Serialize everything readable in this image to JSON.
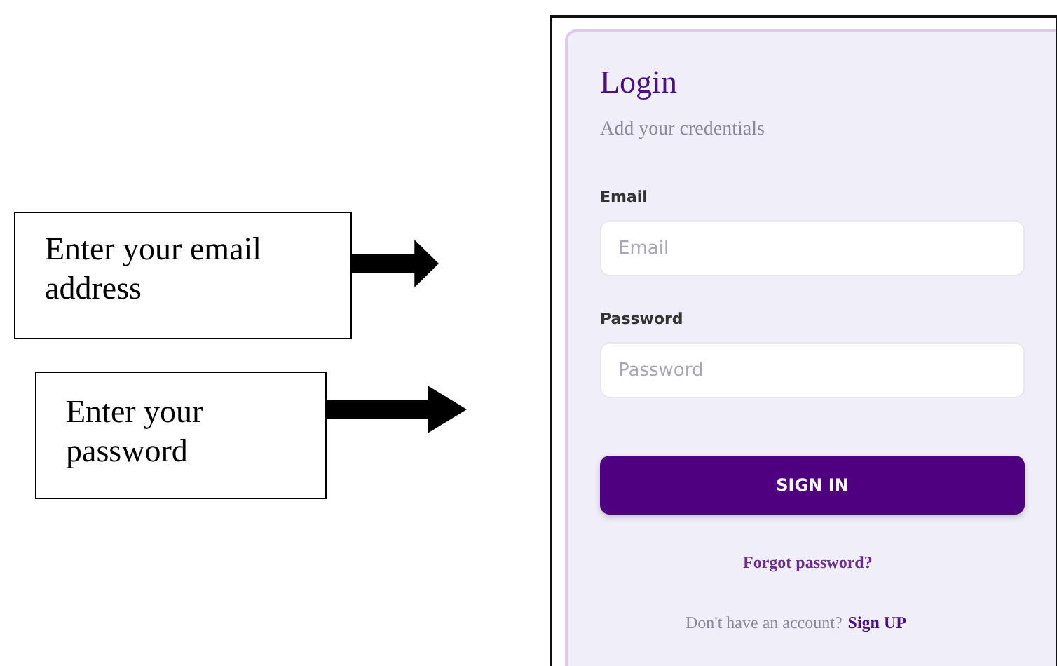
{
  "annotations": [
    {
      "text": "Enter your email address"
    },
    {
      "text": "Enter your password"
    }
  ],
  "login": {
    "title": "Login",
    "subtitle": "Add your credentials",
    "fields": [
      {
        "label": "Email",
        "placeholder": "Email"
      },
      {
        "label": "Password",
        "placeholder": "Password"
      }
    ],
    "button": "SIGN IN",
    "forgot_link": "Forgot password?",
    "signup_prompt": "Don't have an account?",
    "signup_link": "Sign UP"
  }
}
